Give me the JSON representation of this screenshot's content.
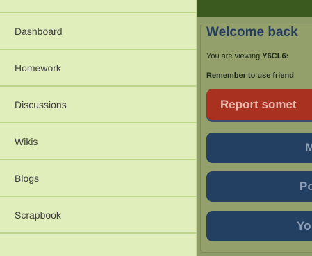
{
  "main": {
    "welcome_heading": "Welcome back",
    "viewing_prefix": "You are viewing ",
    "viewing_class": "Y6CL6:",
    "remember_text": "Remember to use friend",
    "buttons": {
      "report": "Report somet",
      "b1": "M",
      "b2": "Po",
      "b3": "Yo"
    }
  },
  "sidebar": {
    "items": [
      {
        "label": "Dashboard"
      },
      {
        "label": "Homework"
      },
      {
        "label": "Discussions"
      },
      {
        "label": "Wikis"
      },
      {
        "label": "Blogs"
      },
      {
        "label": "Scrapbook"
      }
    ]
  },
  "colors": {
    "drawer_bg": "#e0eebb",
    "top_bar": "#3b5a1f",
    "report_button": "#a8321f",
    "nav_button": "#233f61"
  }
}
